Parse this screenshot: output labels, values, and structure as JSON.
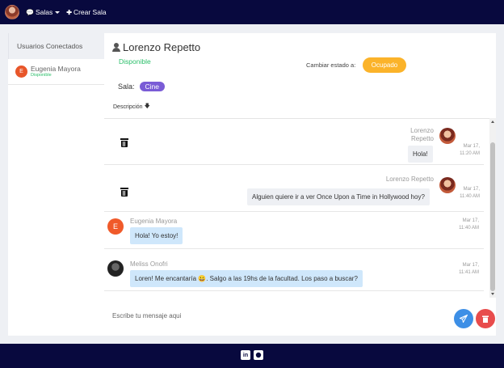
{
  "navbar": {
    "rooms_label": "Salas",
    "create_room_label": "Crear Sala"
  },
  "sidebar": {
    "header": "Usuarios Conectados",
    "users": [
      {
        "initial": "E",
        "name": "Eugenia Mayora",
        "status": "Disponible"
      }
    ]
  },
  "chat": {
    "user_name": "Lorenzo Repetto",
    "status": "Disponible",
    "change_status_label": "Cambiar estado a:",
    "status_button": "Ocupado",
    "room_label": "Sala:",
    "room_name": "Cine",
    "description_label": "Descripción",
    "messages": [
      {
        "author": "Lorenzo Repetto",
        "author_line1": "Lorenzo",
        "author_line2": "Repetto",
        "text": "Hola!",
        "time_line1": "Mar 17,",
        "time_line2": "11:20 AM"
      },
      {
        "author": "Lorenzo Repetto",
        "text": "Alguien quiere ir a ver Once Upon a Time in Hollywood hoy?",
        "time_line1": "Mar 17,",
        "time_line2": "11:40 AM"
      },
      {
        "author": "Eugenia Mayora",
        "initial": "E",
        "text": "Hola! Yo estoy!",
        "time_line1": "Mar 17,",
        "time_line2": "11:40 AM"
      },
      {
        "author": "Meliss Onofri",
        "text": "Loren! Me encantaría 😀. Salgo a las 19hs de la facultad. Los paso a buscar?",
        "time_line1": "Mar 17,",
        "time_line2": "11:41 AM"
      }
    ]
  },
  "composer": {
    "placeholder": "Escribe tu mensaje aqui"
  },
  "colors": {
    "navbar": "#08093e",
    "status_button": "#fbb32a",
    "room_badge": "#7a5cd6",
    "available": "#2bbf6a",
    "send": "#3d8fe6",
    "clear": "#e84c4c"
  }
}
